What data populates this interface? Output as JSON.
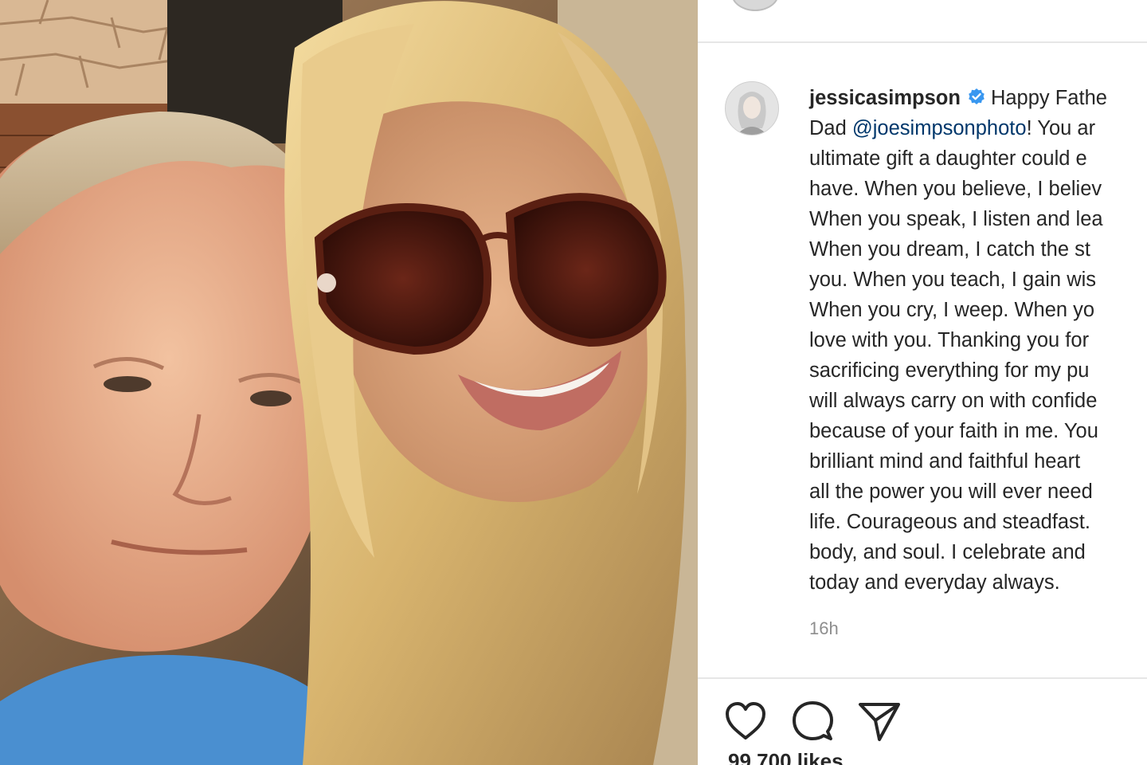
{
  "post": {
    "username": "jessicasimpson",
    "caption_first_line_text": "Happy Fathe",
    "caption_lines": [
      [
        "Dad ",
        "@joesimpsonphoto",
        "! You ar"
      ],
      "ultimate gift a daughter could e",
      "have. When you believe, I believ",
      "When you speak, I listen and lea",
      "When you dream, I catch the st",
      "you. When you teach, I gain wis",
      "When you cry, I weep. When yo",
      "love with you. Thanking you for",
      "sacrificing everything for my pu",
      "will always carry on with confide",
      "because of your faith in me. You",
      "brilliant mind and faithful heart",
      "all the power you will ever need",
      "life. Courageous and steadfast.",
      "body, and soul. I celebrate and",
      "today and everyday always."
    ],
    "mention": "@joesimpsonphoto",
    "timestamp": "16h",
    "likes_text": "99,700 likes"
  },
  "icons": {
    "like": "heart-icon",
    "comment": "comment-icon",
    "share": "share-icon",
    "verified": "verified-badge-icon"
  },
  "colors": {
    "text": "#262626",
    "mention": "#00376b",
    "muted": "#8e8e8e",
    "verified": "#3897f0",
    "divider": "#e6e6e6"
  }
}
